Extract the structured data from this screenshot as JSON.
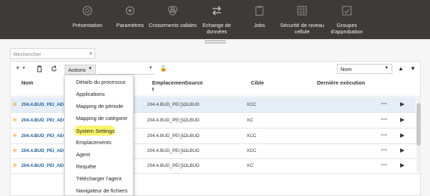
{
  "nav": [
    {
      "label": "Présentation",
      "icon": "overview-icon"
    },
    {
      "label": "Paramètres",
      "icon": "settings-icon"
    },
    {
      "label": "Croisements valides",
      "icon": "intersections-icon"
    },
    {
      "label": "Echange de\ndonnées",
      "icon": "data-exchange-icon"
    },
    {
      "label": "Jobs",
      "icon": "jobs-icon"
    },
    {
      "label": "Sécurité de niveau\ncellule",
      "icon": "cell-security-icon"
    },
    {
      "label": "Groupes\nd'approbation",
      "icon": "approval-groups-icon"
    }
  ],
  "search": {
    "placeholder": "Rechercher"
  },
  "toolbar": {
    "actions_label": "Actions",
    "sort_value": "Nom"
  },
  "columns": {
    "name": "Nom",
    "location": "Emplacemen\nt",
    "source": "Source",
    "target": "Cible",
    "last_run": "Dernière exécution"
  },
  "rows": [
    {
      "name": "204.4.BUD_PEI_AECP_...",
      "location": "204.4.BUD_PEI_...",
      "source": "SOLBUD",
      "target": "XCC",
      "selected": true
    },
    {
      "name": "204.4.BUD_PEI_AECP_...",
      "location": "204.4.BUD_PEI_...",
      "source": "SOLBUD",
      "target": "XC",
      "selected": false
    },
    {
      "name": "204.4.BUD_PEI_AECP_...",
      "location": "204.4.BUD_PEI_...",
      "source": "SOLBUD",
      "target": "XCC",
      "selected": false
    },
    {
      "name": "204.4.BUD_PEI_AECP_...",
      "location": "204.4.BUD_PEI_...",
      "source": "SOLBUD",
      "target": "XCC",
      "selected": false
    },
    {
      "name": "204.4.BUD_PEI_AECP_...",
      "location": "204.4.BUD_PEI_...",
      "source": "SOLBUD",
      "target": "XC'",
      "selected": false
    }
  ],
  "menu": {
    "items": [
      "Détails du processus",
      "Applications",
      "Mapping de période",
      "Mapping de catégorie",
      "System Settings",
      "Emplacements",
      "Agent",
      "Requête",
      "Télécharger l'agent",
      "Navigateur de fichiers"
    ],
    "highlighted_item": "System Settings",
    "highlight_color": "#fbf36a"
  },
  "colors": {
    "nav_bg": "#3d3a37",
    "link": "#1f5e9a",
    "selected_row": "#e5eef7",
    "star": "#f0a020"
  }
}
